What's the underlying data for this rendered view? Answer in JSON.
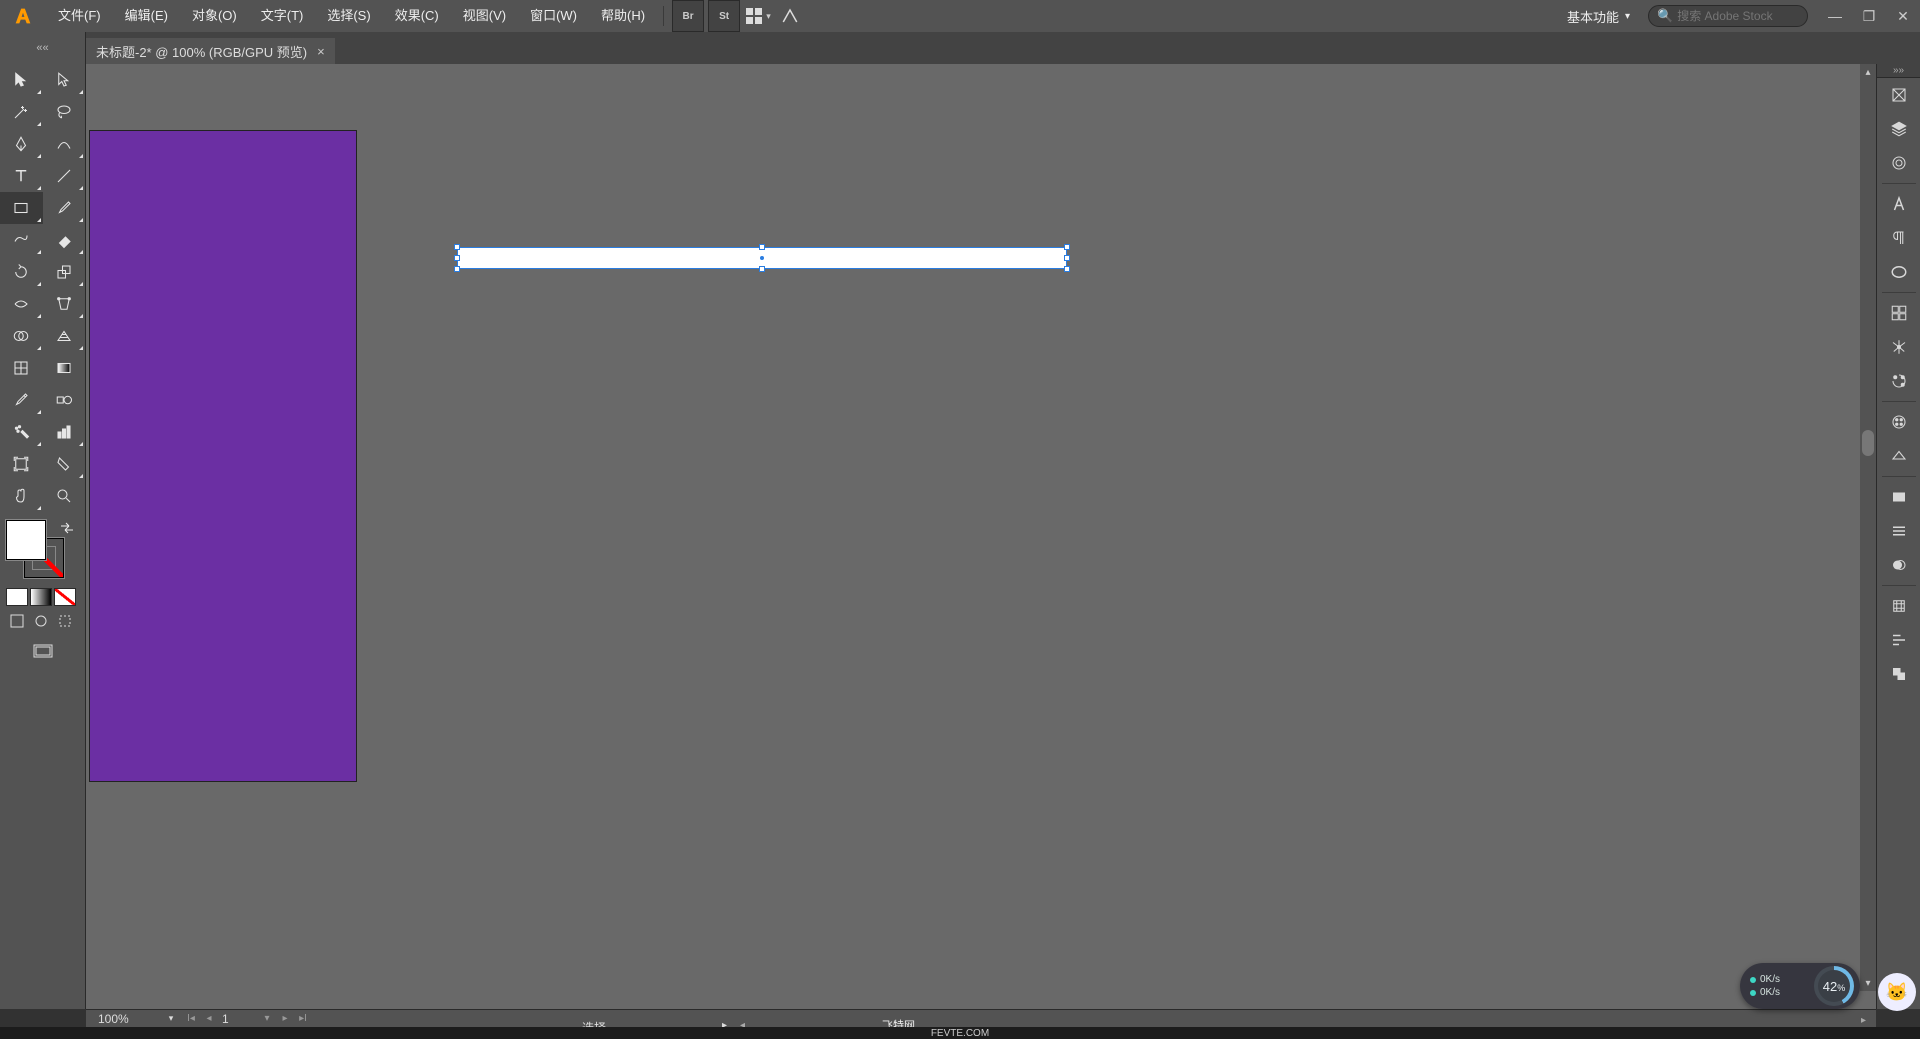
{
  "menubar": {
    "items": [
      "文件(F)",
      "编辑(E)",
      "对象(O)",
      "文字(T)",
      "选择(S)",
      "效果(C)",
      "视图(V)",
      "窗口(W)",
      "帮助(H)"
    ],
    "workspace_label": "基本功能",
    "search_placeholder": "搜索 Adobe Stock"
  },
  "tab": {
    "title": "未标题-2* @ 100% (RGB/GPU 预览)"
  },
  "statusbar": {
    "zoom": "100%",
    "artboard_current": "1",
    "tool_label": "选择",
    "watermark_top": "飞特网",
    "watermark_bottom": "FEVTE.COM"
  },
  "netwidget": {
    "up": "0K/s",
    "down": "0K/s",
    "cpu": "42",
    "cpu_unit": "%"
  },
  "colors": {
    "artboard_fill": "#6b2fa3",
    "selection_fill": "#ffffff",
    "selection_stroke": "#2a7de1"
  },
  "tools_left": [
    [
      "selection",
      "direct-selection"
    ],
    [
      "magic-wand",
      "lasso"
    ],
    [
      "pen",
      "curvature"
    ],
    [
      "type",
      "line-segment"
    ],
    [
      "rectangle",
      "paintbrush"
    ],
    [
      "shaper",
      "eraser"
    ],
    [
      "rotate",
      "scale"
    ],
    [
      "width",
      "free-transform"
    ],
    [
      "shape-builder",
      "perspective-grid"
    ],
    [
      "mesh",
      "gradient"
    ],
    [
      "eyedropper",
      "blend"
    ],
    [
      "symbol-sprayer",
      "column-graph"
    ],
    [
      "artboard",
      "slice"
    ],
    [
      "hand",
      "zoom"
    ]
  ],
  "panels_right": [
    {
      "name": "libraries",
      "label": ""
    },
    {
      "name": "layers",
      "label": ""
    },
    {
      "name": "cc-libraries",
      "label": ""
    },
    {
      "name": "character",
      "label": ""
    },
    {
      "name": "paragraph",
      "label": ""
    },
    {
      "name": "opentype",
      "label": ""
    },
    {
      "name": "transform",
      "label": ""
    },
    {
      "name": "color-guide",
      "label": ""
    },
    {
      "name": "recolor",
      "label": ""
    },
    {
      "name": "swatches",
      "label": ""
    },
    {
      "name": "gradient",
      "label": ""
    },
    {
      "name": "transparency",
      "label": ""
    },
    {
      "name": "stroke",
      "label": ""
    },
    {
      "name": "brushes",
      "label": ""
    },
    {
      "name": "align",
      "label": ""
    },
    {
      "name": "pathfinder",
      "label": ""
    }
  ]
}
